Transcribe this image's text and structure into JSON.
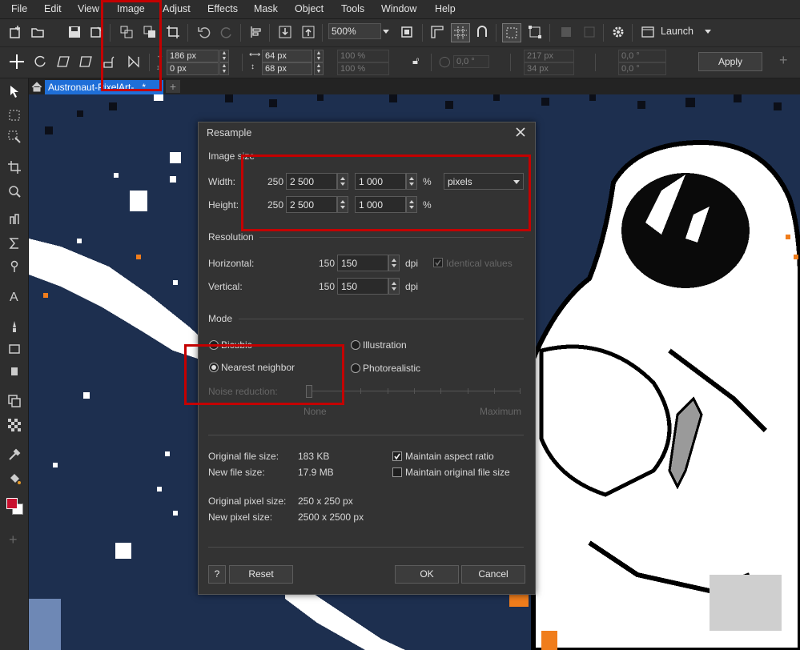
{
  "menubar": {
    "items": [
      "File",
      "Edit",
      "View",
      "Image",
      "Adjust",
      "Effects",
      "Mask",
      "Object",
      "Tools",
      "Window",
      "Help"
    ]
  },
  "toolbar": {
    "zoom": "500%",
    "launch_label": "Launch",
    "x_value": "186 px",
    "y_value": "0 px",
    "w_value": "64 px",
    "h_value": "68 px",
    "scale_w": "100 %",
    "scale_h": "100 %",
    "angle_value": "0,0 °",
    "pos2_x": "217 px",
    "pos2_y": "34 px",
    "skew_x": "0,0 °",
    "skew_y": "0,0 °",
    "apply_label": "Apply"
  },
  "document_tab": {
    "title": "Austronaut-PixelArt-...*"
  },
  "dialog": {
    "title": "Resample",
    "image_size_label": "Image size",
    "width_label": "Width:",
    "height_label": "Height:",
    "width_orig": "250",
    "height_orig": "250",
    "width_value": "2 500",
    "height_value": "2 500",
    "width_pct": "1 000",
    "height_pct": "1 000",
    "pct_unit": "%",
    "unit_select": "pixels",
    "resolution_label": "Resolution",
    "horizontal_label": "Horizontal:",
    "vertical_label": "Vertical:",
    "horiz_orig": "150",
    "vert_orig": "150",
    "horiz_value": "150",
    "vert_value": "150",
    "dpi_unit": "dpi",
    "identical_values": "Identical values",
    "mode_label": "Mode",
    "mode_bicubic": "Bicubic",
    "mode_illustration": "Illustration",
    "mode_nearest": "Nearest neighbor",
    "mode_photorealistic": "Photorealistic",
    "noise_reduction": "Noise reduction:",
    "slider_min": "None",
    "slider_max": "Maximum",
    "orig_file_size_label": "Original file size:",
    "orig_file_size": "183 KB",
    "new_file_size_label": "New file size:",
    "new_file_size": "17.9 MB",
    "orig_pixel_size_label": "Original pixel size:",
    "orig_pixel_size": "250 x 250 px",
    "new_pixel_size_label": "New pixel size:",
    "new_pixel_size": "2500 x 2500 px",
    "maintain_aspect": "Maintain aspect ratio",
    "maintain_file_size": "Maintain original file size",
    "help_label": "?",
    "reset_label": "Reset",
    "ok_label": "OK",
    "cancel_label": "Cancel"
  },
  "colors": {
    "highlight": "#c40000",
    "tab_active": "#1f6fd8",
    "foreground_swatch": "#c8102e",
    "background_swatch": "#ffffff"
  }
}
